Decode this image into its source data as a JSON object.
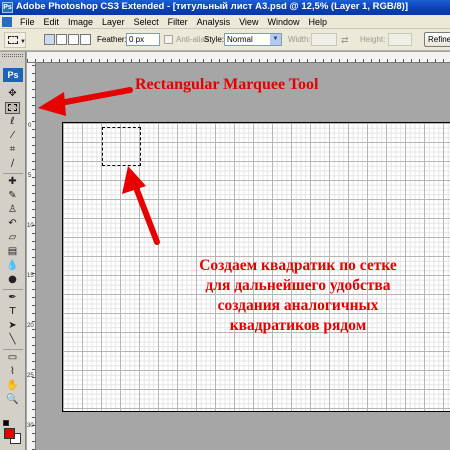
{
  "window": {
    "title": "Adobe Photoshop CS3 Extended - [титульный лист А3.psd @ 12,5% (Layer 1, RGB/8)]",
    "app_icon": "Ps"
  },
  "menu": [
    "File",
    "Edit",
    "Image",
    "Layer",
    "Select",
    "Filter",
    "Analysis",
    "View",
    "Window",
    "Help"
  ],
  "options": {
    "feather_label": "Feather:",
    "feather_value": "0 px",
    "anti_alias_label": "Anti-alias",
    "style_label": "Style:",
    "style_value": "Normal",
    "width_label": "Width:",
    "height_label": "Height:",
    "refine_label": "Refine"
  },
  "toolbox": {
    "logo": "Ps",
    "selected_tool": "rectangular-marquee",
    "foreground_color": "#e60000",
    "background_color": "#ffffff"
  },
  "annotations": {
    "tool_caption": "Rectangular Marquee Tool",
    "grid_note_lines": [
      "Создаем квадратик по сетке",
      "для дальнейшего удобства",
      "создания аналогичных",
      "квадратиков рядом"
    ],
    "accent_color": "#e60000"
  },
  "ruler": {
    "left_marks": [
      "0",
      "5",
      "10",
      "15",
      "20",
      "25",
      "30"
    ]
  }
}
